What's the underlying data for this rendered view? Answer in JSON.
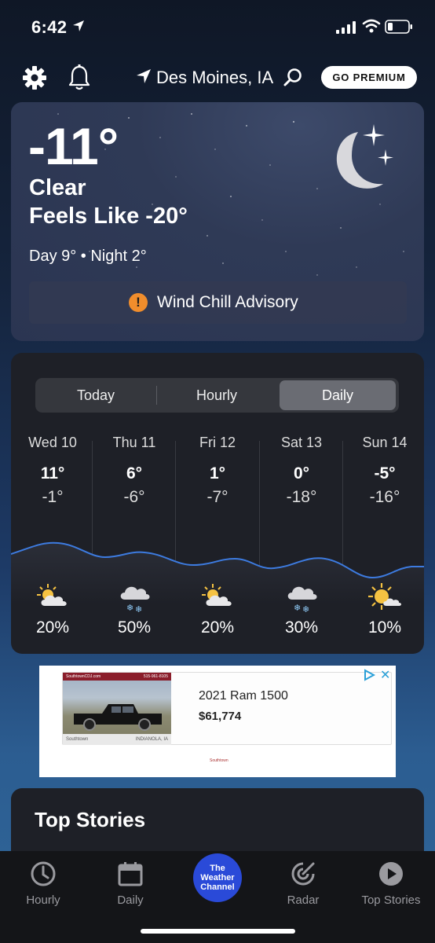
{
  "status_bar": {
    "time": "6:42"
  },
  "header": {
    "location": "Des Moines, IA",
    "premium_label": "GO PREMIUM"
  },
  "current": {
    "temperature": "-11°",
    "condition": "Clear",
    "feels_like": "Feels Like -20°",
    "day_night": "Day 9° • Night 2°",
    "alert": "Wind Chill Advisory",
    "icon": "moon-stars-icon"
  },
  "forecast": {
    "tabs": [
      "Today",
      "Hourly",
      "Daily"
    ],
    "selected_tab": "Daily",
    "days": [
      {
        "day": "Wed 10",
        "high": "11°",
        "low": "-1°",
        "icon": "partly-cloudy-icon",
        "precip": "20%"
      },
      {
        "day": "Thu 11",
        "high": "6°",
        "low": "-6°",
        "icon": "snow-icon",
        "precip": "50%"
      },
      {
        "day": "Fri 12",
        "high": "1°",
        "low": "-7°",
        "icon": "partly-cloudy-icon",
        "precip": "20%"
      },
      {
        "day": "Sat 13",
        "high": "0°",
        "low": "-18°",
        "icon": "snow-icon",
        "precip": "30%"
      },
      {
        "day": "Sun 14",
        "high": "-5°",
        "low": "-16°",
        "icon": "mostly-sunny-icon",
        "precip": "10%"
      }
    ]
  },
  "ad": {
    "model": "2021 Ram 1500",
    "price": "$61,774",
    "dealer_site": "SouthtownCDJ.com",
    "dealer_phone": "515-961-8105",
    "dealer_name": "Southtown",
    "dealer_city": "INDIANOLA, IA"
  },
  "top_stories": {
    "title": "Top Stories"
  },
  "tab_bar": {
    "items": [
      "Hourly",
      "Daily",
      "Radar",
      "Top Stories"
    ],
    "logo": [
      "The",
      "Weather",
      "Channel"
    ]
  },
  "colors": {
    "accent_line": "#3d7be0",
    "alert_orange": "#f08d2c",
    "logo_blue": "#2a4ad8"
  }
}
